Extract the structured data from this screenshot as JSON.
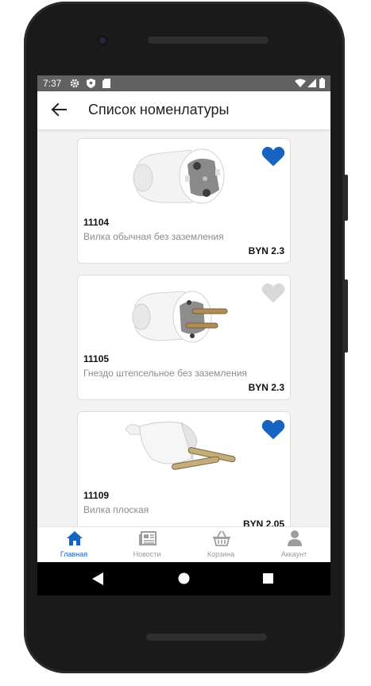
{
  "status_bar": {
    "time": "7:37",
    "left_icons": [
      "gear-icon",
      "shield-icon",
      "sim-card-icon"
    ],
    "right_icons": [
      "wifi-icon",
      "signal-icon",
      "battery-icon"
    ]
  },
  "app_bar": {
    "back_icon": "arrow-left-icon",
    "title": "Список номенлатуры"
  },
  "products": [
    {
      "code": "11104",
      "name": "Вилка обычная без заземления",
      "price": "BYN 2.3",
      "favorite": true,
      "image": "round-plug-image"
    },
    {
      "code": "11105",
      "name": "Гнездо штепсельное без заземления",
      "price": "BYN 2.3",
      "favorite": false,
      "image": "plug-with-pins-image"
    },
    {
      "code": "11109",
      "name": "Вилка плоская",
      "price": "BYN 2.05",
      "favorite": true,
      "image": "flat-plug-image"
    }
  ],
  "bottom_nav": [
    {
      "label": "Главная",
      "icon": "home-icon",
      "active": true
    },
    {
      "label": "Новости",
      "icon": "newspaper-icon",
      "active": false
    },
    {
      "label": "Корзина",
      "icon": "basket-icon",
      "active": false
    },
    {
      "label": "Аккаунт",
      "icon": "user-icon",
      "active": false
    }
  ],
  "colors": {
    "accent": "#1565c0",
    "heart_active": "#1565c0",
    "heart_inactive": "#d9d9d9",
    "status_bar": "#616161",
    "background": "#f2f2f2"
  }
}
